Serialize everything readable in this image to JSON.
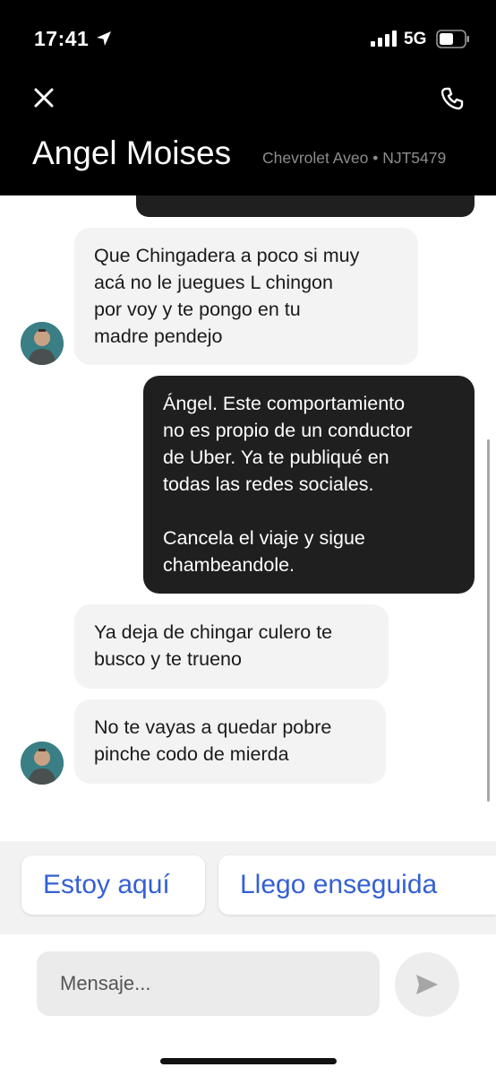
{
  "status_bar": {
    "time": "17:41",
    "network": "5G"
  },
  "header": {
    "contact_name": "Angel Moises",
    "vehicle": "Chevrolet Aveo • NJT5479"
  },
  "messages": [
    {
      "from": "driver",
      "text": "Que Chingadera a poco si muy\nacá no le juegues L chingon\npor voy y  te pongo en tu\nmadre pendejo"
    },
    {
      "from": "me",
      "text": "Ángel. Este comportamiento\nno es propio de un conductor\nde Uber. Ya te publiqué en\ntodas las redes sociales.\n\nCancela el viaje y sigue\nchambeandole."
    },
    {
      "from": "driver",
      "text": "Ya deja de chingar culero te\nbusco y te trueno"
    },
    {
      "from": "driver",
      "text": "No te vayas a quedar pobre\npinche codo de mierda"
    }
  ],
  "quick_replies": [
    "Estoy aquí",
    "Llego enseguida"
  ],
  "composer": {
    "placeholder": "Mensaje..."
  },
  "colors": {
    "header_bg": "#000000",
    "outgoing_bubble": "#1f1f1f",
    "incoming_bubble": "#f3f3f3",
    "quick_reply_text": "#3560d4"
  },
  "icons": {
    "close": "close-icon",
    "phone": "phone-icon",
    "send": "send-icon",
    "location": "location-arrow-icon"
  }
}
